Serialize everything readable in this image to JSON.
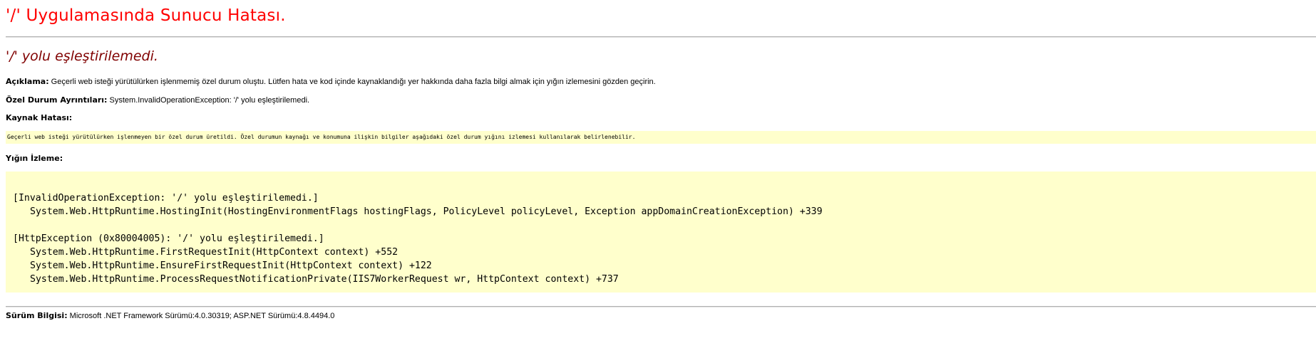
{
  "page": {
    "title": "'/' Uygulamasında Sunucu Hatası.",
    "subtitle": "'/' yolu eşleştirilemedi.",
    "colors": {
      "title": "#ff0000",
      "subtitle": "#800000",
      "code_background": "#ffffcc",
      "rule": "#b0b0b0"
    }
  },
  "description": {
    "label": "Açıklama:",
    "text": " Geçerli web isteği yürütülürken işlenmemiş özel durum oluştu. Lütfen hata ve kod içinde kaynaklandığı yer hakkında daha fazla bilgi almak için yığın izlemesini gözden geçirin."
  },
  "exception_details": {
    "label": "Özel Durum Ayrıntıları:",
    "text": " System.InvalidOperationException: '/' yolu eşleştirilemedi."
  },
  "source_error": {
    "label": "Kaynak Hatası:",
    "text": "Geçerli web isteği yürütülürken işlenmeyen bir özel durum üretildi. Özel durumun kaynağı ve konumuna ilişkin bilgiler aşağıdaki özel durum yığını izlemesi kullanılarak belirlenebilir."
  },
  "stack_trace": {
    "label": "Yığın İzleme:",
    "lines": [
      "[InvalidOperationException: '/' yolu eşleştirilemedi.]",
      "System.Web.HttpRuntime.HostingInit(HostingEnvironmentFlags hostingFlags, PolicyLevel policyLevel, Exception appDomainCreationException) +339",
      "[HttpException (0x80004005): '/' yolu eşleştirilemedi.]",
      "System.Web.HttpRuntime.FirstRequestInit(HttpContext context) +552",
      "System.Web.HttpRuntime.EnsureFirstRequestInit(HttpContext context) +122",
      "System.Web.HttpRuntime.ProcessRequestNotificationPrivate(IIS7WorkerRequest wr, HttpContext context) +737"
    ]
  },
  "version_info": {
    "label": "Sürüm Bilgisi:",
    "text": " Microsoft .NET Framework Sürümü:4.0.30319; ASP.NET Sürümü:4.8.4494.0"
  }
}
